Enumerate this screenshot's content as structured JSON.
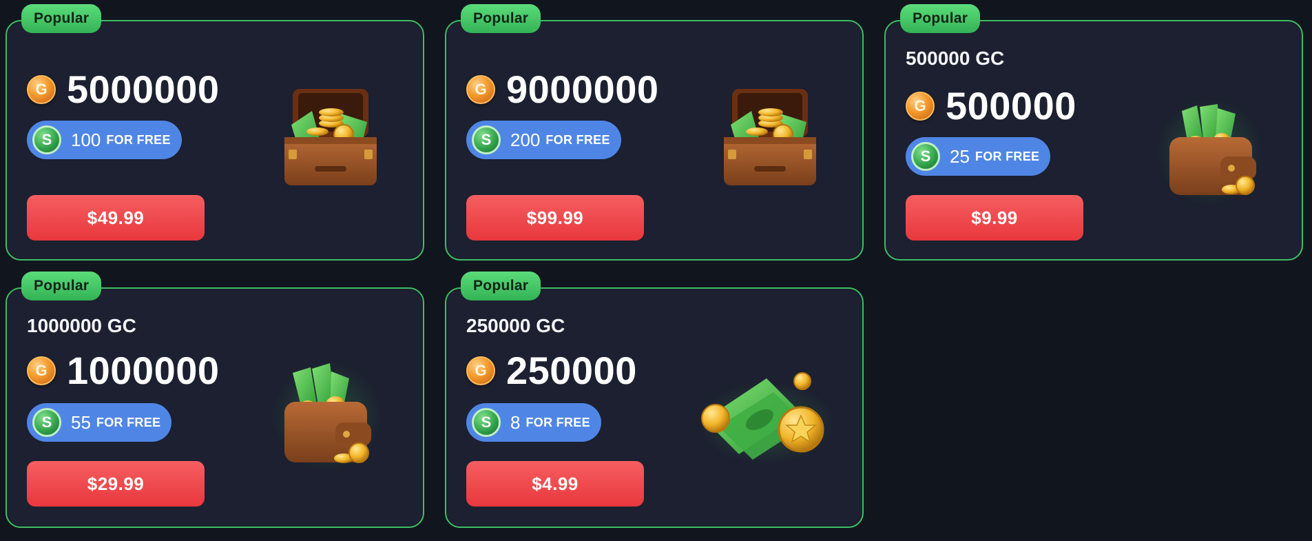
{
  "currency_icon": "gold-coin-g-icon",
  "free_icon": "sweeps-coin-s-icon",
  "colors": {
    "background": "#11161e",
    "card": "#1c2030",
    "card_border": "#3fbf65",
    "badge": "#4fd06e",
    "free_pill": "#4f86e6",
    "buy_button": "#ef4a4e"
  },
  "cards": [
    {
      "badge": "Popular",
      "title": "",
      "coin_letter": "G",
      "amount": "5000000",
      "free_letter": "S",
      "free_amount": "100",
      "free_text": "FOR FREE",
      "price": "$49.99",
      "art": "treasure-chest-illustration"
    },
    {
      "badge": "Popular",
      "title": "",
      "coin_letter": "G",
      "amount": "9000000",
      "free_letter": "S",
      "free_amount": "200",
      "free_text": "FOR FREE",
      "price": "$99.99",
      "art": "treasure-chest-illustration"
    },
    {
      "badge": "Popular",
      "title": "500000 GC",
      "coin_letter": "G",
      "amount": "500000",
      "free_letter": "S",
      "free_amount": "25",
      "free_text": "FOR FREE",
      "price": "$9.99",
      "art": "wallet-with-cash-illustration"
    },
    {
      "badge": "Popular",
      "title": "1000000 GC",
      "coin_letter": "G",
      "amount": "1000000",
      "free_letter": "S",
      "free_amount": "55",
      "free_text": "FOR FREE",
      "price": "$29.99",
      "art": "wallet-with-cash-illustration"
    },
    {
      "badge": "Popular",
      "title": "250000 GC",
      "coin_letter": "G",
      "amount": "250000",
      "free_letter": "S",
      "free_amount": "8",
      "free_text": "FOR FREE",
      "price": "$4.99",
      "art": "cash-and-coins-illustration"
    }
  ]
}
